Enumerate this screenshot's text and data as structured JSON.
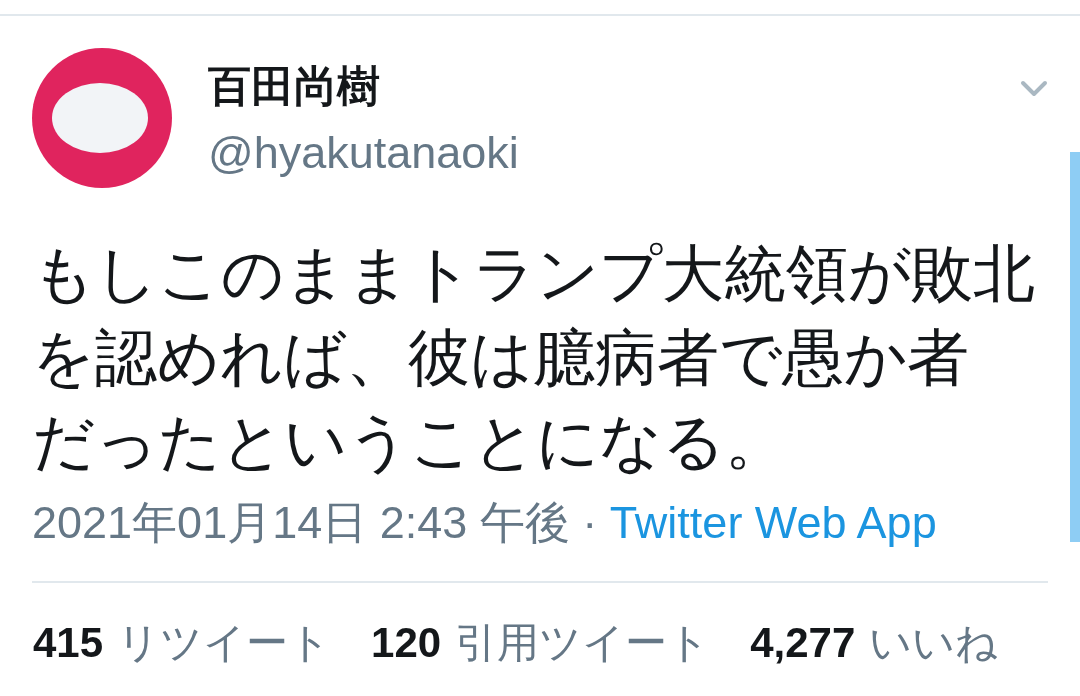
{
  "author": {
    "name": "百田尚樹",
    "handle": "@hyakutanaoki"
  },
  "tweet": {
    "text": "もしこのままトランプ大統領が敗北を認めれば、彼は臆病者で愚か者だったということになる。",
    "timestamp": "2021年01月14日 2:43 午後",
    "separator": "·",
    "source": "Twitter Web App"
  },
  "stats": [
    {
      "count": "415",
      "label": "リツイート"
    },
    {
      "count": "120",
      "label": "引用ツイート"
    },
    {
      "count": "4,277",
      "label": "いいね"
    }
  ]
}
